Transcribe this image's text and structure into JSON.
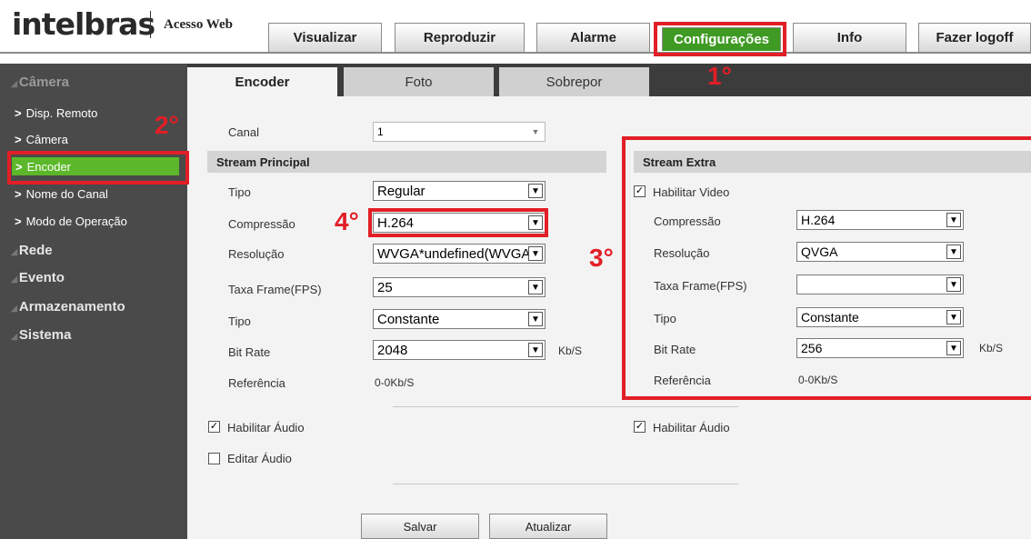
{
  "header": {
    "logo_text": "intelbras",
    "app_name": "Acesso Web",
    "nav_tabs": [
      {
        "label": "Visualizar"
      },
      {
        "label": "Reproduzir"
      },
      {
        "label": "Alarme"
      },
      {
        "label": "Configurações",
        "active": true
      },
      {
        "label": "Info"
      },
      {
        "label": "Fazer logoff"
      }
    ]
  },
  "sidebar": {
    "groups": [
      {
        "label": "Câmera",
        "current": true
      },
      {
        "label": "Rede"
      },
      {
        "label": "Evento"
      },
      {
        "label": "Armazenamento"
      },
      {
        "label": "Sistema"
      }
    ],
    "camera_items": [
      {
        "label": "Disp. Remoto"
      },
      {
        "label": "Câmera"
      },
      {
        "label": "Encoder",
        "active": true
      },
      {
        "label": "Nome do Canal"
      },
      {
        "label": "Modo de Operação"
      }
    ]
  },
  "subtabs": [
    {
      "label": "Encoder",
      "active": true
    },
    {
      "label": "Foto"
    },
    {
      "label": "Sobrepor"
    }
  ],
  "form": {
    "canal_label": "Canal",
    "canal_value": "1",
    "principal": {
      "title": "Stream Principal",
      "tipo_label": "Tipo",
      "tipo_value": "Regular",
      "compressao_label": "Compressão",
      "compressao_value": "H.264",
      "resolucao_label": "Resolução",
      "resolucao_value": "WVGA*undefined(WVGA)",
      "taxa_label": "Taxa Frame(FPS)",
      "taxa_value": "25",
      "tipo2_label": "Tipo",
      "tipo2_value": "Constante",
      "bitrate_label": "Bit Rate",
      "bitrate_value": "2048",
      "bitrate_unit": "Kb/S",
      "referencia_label": "Referência",
      "referencia_value": "0-0Kb/S",
      "audio_label": "Habilitar Áudio",
      "audio_checked": true,
      "editar_audio_label": "Editar Áudio",
      "editar_audio_checked": false
    },
    "extra": {
      "title": "Stream Extra",
      "video_label": "Habilitar Video",
      "video_checked": true,
      "compressao_label": "Compressão",
      "compressao_value": "H.264",
      "resolucao_label": "Resolução",
      "resolucao_value": "QVGA",
      "taxa_label": "Taxa Frame(FPS)",
      "taxa_value": "",
      "tipo_label": "Tipo",
      "tipo_value": "Constante",
      "bitrate_label": "Bit Rate",
      "bitrate_value": "256",
      "bitrate_unit": "Kb/S",
      "referencia_label": "Referência",
      "referencia_value": "0-0Kb/S",
      "audio_label": "Habilitar Áudio",
      "audio_checked": true
    },
    "buttons": {
      "salvar": "Salvar",
      "atualizar": "Atualizar"
    }
  },
  "annotations": {
    "step1": "1°",
    "step2": "2°",
    "step3": "3°",
    "step4": "4°",
    "color": "#e21e26"
  },
  "colors": {
    "accent_green": "#3f9a23",
    "sidebar_active": "#5cb82a",
    "sidebar_bg": "#4a4a4a"
  }
}
